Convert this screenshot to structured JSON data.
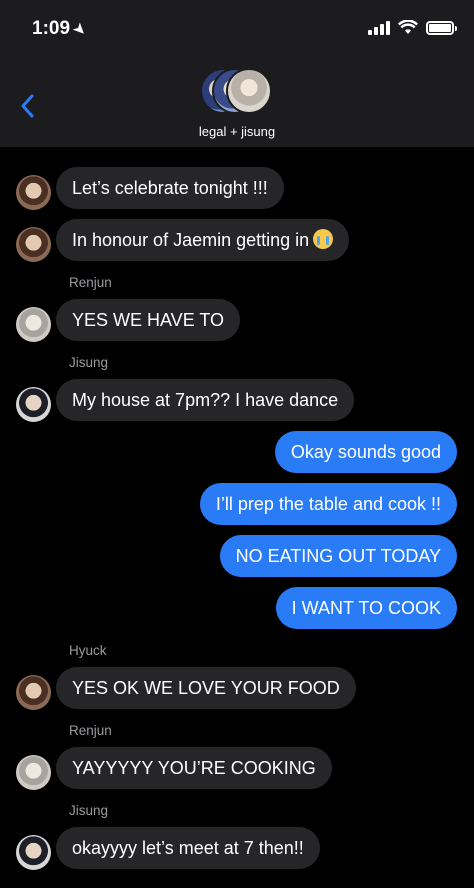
{
  "status": {
    "time": "1:09"
  },
  "header": {
    "group_name": "legal + jisung"
  },
  "messages": [
    {
      "text": "Let’s celebrate tonight !!!"
    },
    {
      "text": "In honour of Jaemin getting in"
    },
    {
      "sender": "Renjun",
      "text": "YES WE HAVE TO"
    },
    {
      "sender": "Jisung",
      "text": "My house at 7pm?? I have dance"
    },
    {
      "text": "Okay sounds good"
    },
    {
      "text": "I’ll prep the table and cook !!"
    },
    {
      "text": "NO EATING OUT TODAY"
    },
    {
      "text": "I WANT TO COOK"
    },
    {
      "sender": "Hyuck",
      "text": "YES OK WE LOVE YOUR FOOD"
    },
    {
      "sender": "Renjun",
      "text": "YAYYYYY YOU’RE COOKING"
    },
    {
      "sender": "Jisung",
      "text": "okayyyy let’s meet at 7 then!!"
    }
  ],
  "colors": {
    "outgoing": "#2a7cf6",
    "incoming": "#262628",
    "header": "#1c1c1e",
    "accent": "#2a7cf6"
  },
  "icons": {
    "back": "chevron-left-icon",
    "location": "location-arrow-icon",
    "emoji": "loudly-crying-face-emoji"
  }
}
